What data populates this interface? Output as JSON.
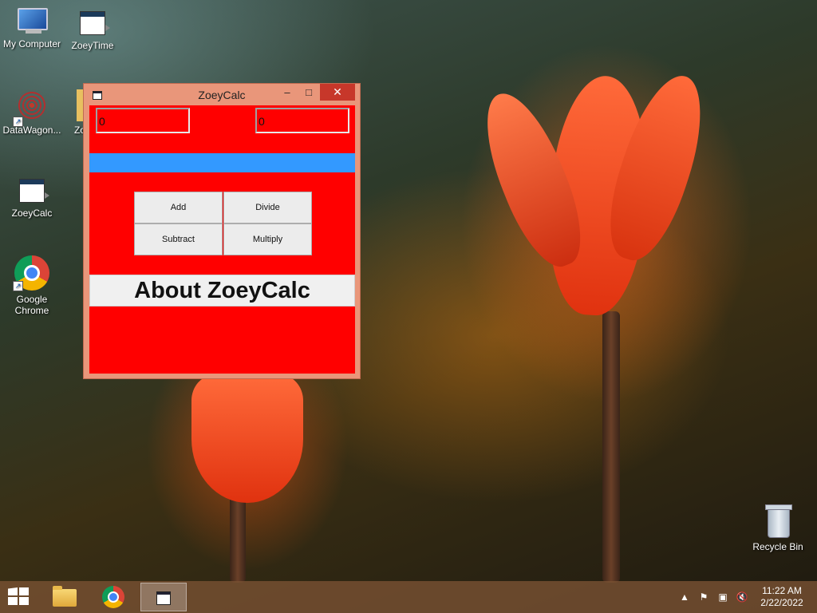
{
  "desktop": {
    "icons": [
      {
        "label": "My Computer"
      },
      {
        "label": "ZoeyTime"
      },
      {
        "label": "DataWagon..."
      },
      {
        "label": "Zo"
      },
      {
        "label": "ZoeyCalc"
      },
      {
        "label": "Google Chrome"
      },
      {
        "label": "Recycle Bin"
      }
    ]
  },
  "window": {
    "title": "ZoeyCalc",
    "controls": {
      "minimize": "–",
      "maximize": "□",
      "close": "✕"
    },
    "inputs": [
      {
        "value": "0"
      },
      {
        "value": "0"
      }
    ],
    "buttons": {
      "add": "Add",
      "divide": "Divide",
      "subtract": "Subtract",
      "multiply": "Multiply",
      "about": "About ZoeyCalc"
    },
    "colors": {
      "client_bg": "#ff0000",
      "bar": "#3399ff",
      "frame": "#e9967a"
    }
  },
  "taskbar": {
    "items": [
      "start-icon",
      "file-explorer-icon",
      "chrome-icon",
      "zoeycalc-icon"
    ],
    "tray": {
      "time": "11:22 AM",
      "date": "2/22/2022"
    }
  }
}
